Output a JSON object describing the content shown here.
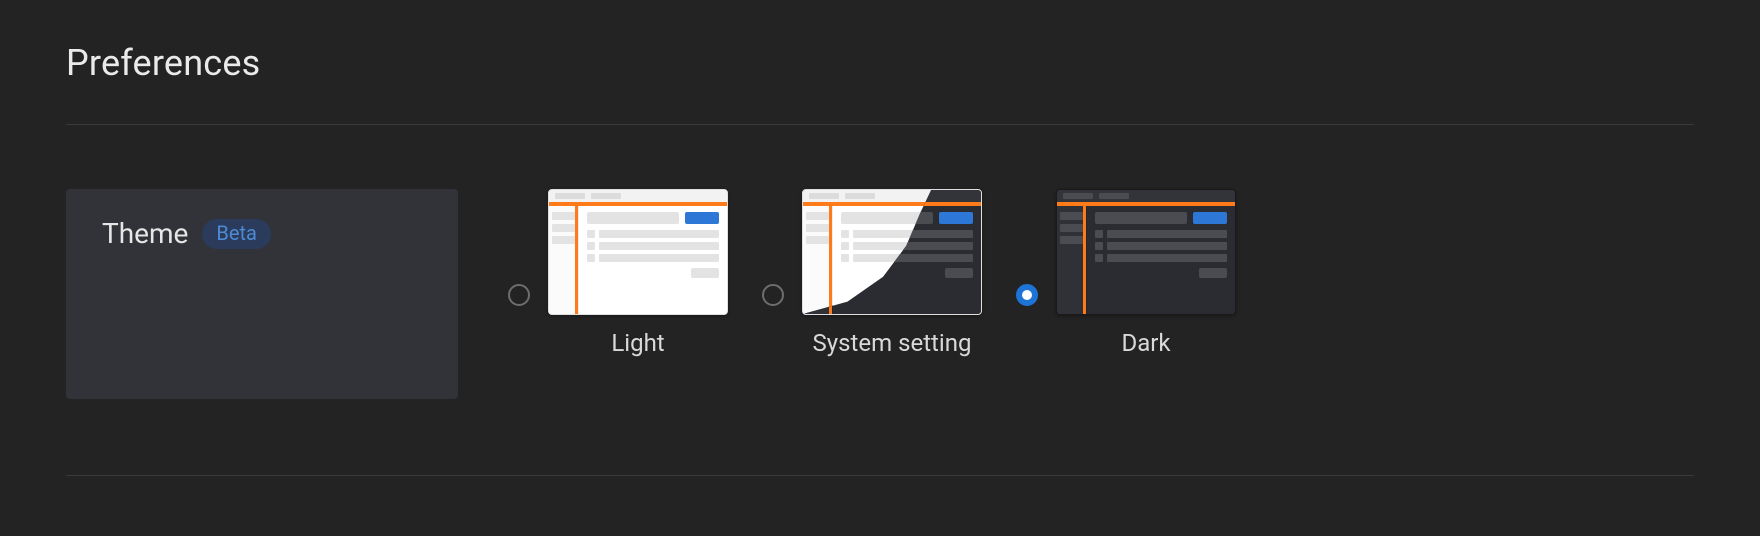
{
  "page_title": "Preferences",
  "theme_section": {
    "label": "Theme",
    "badge": "Beta",
    "options": [
      {
        "id": "light",
        "label": "Light",
        "selected": false
      },
      {
        "id": "system",
        "label": "System setting",
        "selected": false
      },
      {
        "id": "dark",
        "label": "Dark",
        "selected": true
      }
    ]
  },
  "colors": {
    "accent_orange": "#ff7a18",
    "accent_blue": "#2d78d6",
    "panel_bg": "#313338",
    "page_bg": "#232323"
  }
}
